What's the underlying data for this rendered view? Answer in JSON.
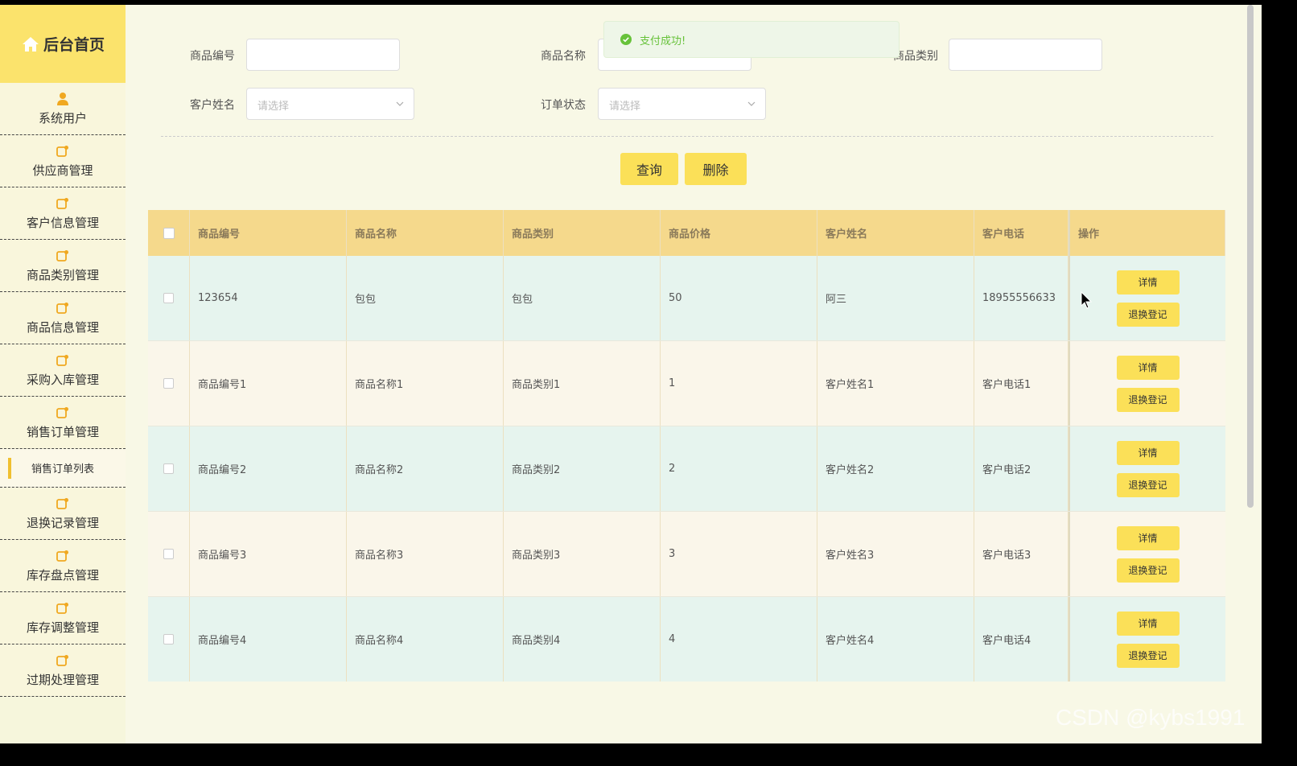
{
  "sidebar": {
    "title": "后台首页",
    "items": [
      {
        "label": "系统用户",
        "icon": "user-icon"
      },
      {
        "label": "供应商管理",
        "icon": "edit-icon"
      },
      {
        "label": "客户信息管理",
        "icon": "edit-icon"
      },
      {
        "label": "商品类别管理",
        "icon": "edit-icon"
      },
      {
        "label": "商品信息管理",
        "icon": "edit-icon"
      },
      {
        "label": "采购入库管理",
        "icon": "edit-icon"
      },
      {
        "label": "销售订单管理",
        "icon": "edit-icon"
      }
    ],
    "sub_item": {
      "label": "销售订单列表"
    },
    "items_after": [
      {
        "label": "退换记录管理",
        "icon": "edit-icon"
      },
      {
        "label": "库存盘点管理",
        "icon": "edit-icon"
      },
      {
        "label": "库存调整管理",
        "icon": "edit-icon"
      },
      {
        "label": "过期处理管理",
        "icon": "edit-icon"
      }
    ]
  },
  "search": {
    "product_code_label": "商品编号",
    "product_code_value": "",
    "product_name_label": "商品名称",
    "product_name_value": "",
    "product_category_label": "商品类别",
    "product_category_value": "",
    "customer_name_label": "客户姓名",
    "customer_name_placeholder": "请选择",
    "order_status_label": "订单状态",
    "order_status_placeholder": "请选择",
    "query_label": "查询",
    "delete_label": "删除"
  },
  "toast": {
    "message": "支付成功!",
    "icon": "success-check-icon",
    "color": "#67c23a"
  },
  "table": {
    "headers": [
      "商品编号",
      "商品名称",
      "商品类别",
      "商品价格",
      "客户姓名",
      "客户电话",
      "操作"
    ],
    "rows": [
      [
        "123654",
        "包包",
        "包包",
        "50",
        "阿三",
        "18955556633"
      ],
      [
        "商品编号1",
        "商品名称1",
        "商品类别1",
        "1",
        "客户姓名1",
        "客户电话1"
      ],
      [
        "商品编号2",
        "商品名称2",
        "商品类别2",
        "2",
        "客户姓名2",
        "客户电话2"
      ],
      [
        "商品编号3",
        "商品名称3",
        "商品类别3",
        "3",
        "客户姓名3",
        "客户电话3"
      ],
      [
        "商品编号4",
        "商品名称4",
        "商品类别4",
        "4",
        "客户姓名4",
        "客户电话4"
      ]
    ],
    "detail_label": "详情",
    "return_label": "退换登记"
  },
  "colors": {
    "accent": "#fbe058",
    "header": "#f5d98c",
    "sidebar_logo": "#fbe36c"
  },
  "watermark": "CSDN @kybs1991"
}
